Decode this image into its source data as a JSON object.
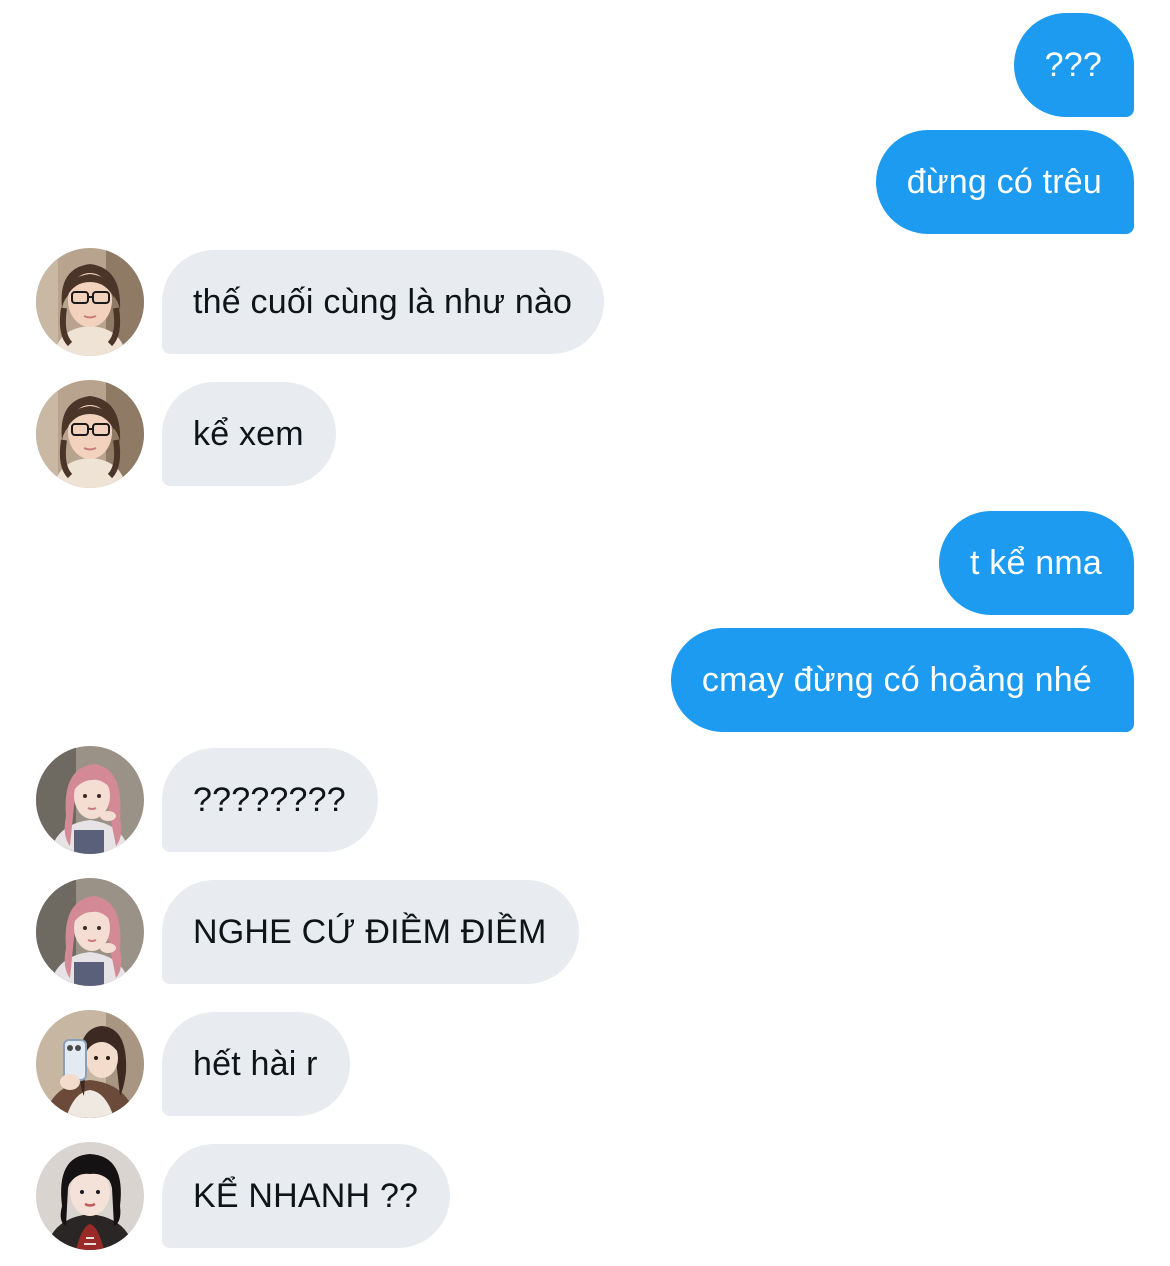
{
  "messages": [
    {
      "side": "sent",
      "text": "???"
    },
    {
      "side": "sent",
      "text": "đừng có trêu"
    },
    {
      "side": "received",
      "text": "thế cuối cùng là như nào",
      "avatar": "avatar-glasses-girl"
    },
    {
      "side": "received",
      "text": "kể xem",
      "avatar": "avatar-glasses-girl"
    },
    {
      "side": "sent",
      "text": "t kể nma"
    },
    {
      "side": "sent",
      "text": "cmay đừng có hoảng nhé"
    },
    {
      "side": "received",
      "text": "????????",
      "avatar": "avatar-pink-hair-girl"
    },
    {
      "side": "received",
      "text": "NGHE CỨ ĐIỀM ĐIỀM",
      "avatar": "avatar-pink-hair-girl"
    },
    {
      "side": "received",
      "text": "hết hài r",
      "avatar": "avatar-mirror-selfie-girl"
    },
    {
      "side": "received",
      "text": "KỂ NHANH ??",
      "avatar": "avatar-black-hair-girl"
    }
  ],
  "colors": {
    "sent_bubble": "#1d9bf0",
    "sent_text": "#ffffff",
    "received_bubble": "#e8ecf0",
    "received_text": "#0f1419",
    "background": "#ffffff"
  }
}
